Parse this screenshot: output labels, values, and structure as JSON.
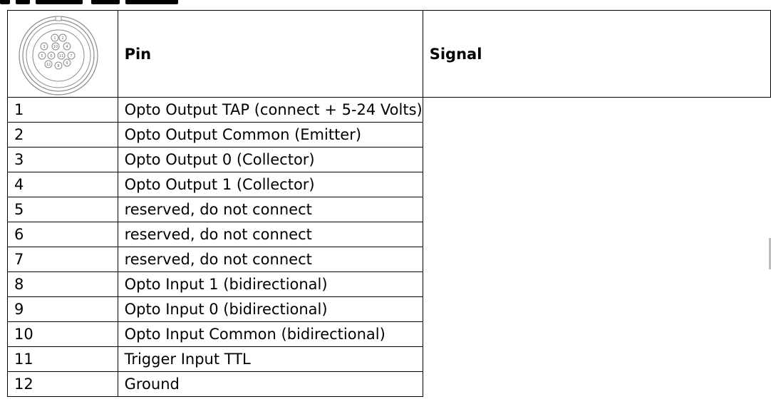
{
  "table": {
    "headers": {
      "pin": "Pin",
      "signal": "Signal"
    },
    "rows": [
      {
        "pin": "1",
        "signal": "Opto Output TAP (connect + 5-24 Volts)"
      },
      {
        "pin": "2",
        "signal": "Opto Output Common (Emitter)"
      },
      {
        "pin": "3",
        "signal": "Opto Output 0 (Collector)"
      },
      {
        "pin": "4",
        "signal": "Opto Output 1 (Collector)"
      },
      {
        "pin": "5",
        "signal": "reserved, do not connect"
      },
      {
        "pin": "6",
        "signal": "reserved, do not connect"
      },
      {
        "pin": "7",
        "signal": "reserved, do not connect"
      },
      {
        "pin": "8",
        "signal": "Opto Input 1 (bidirectional)"
      },
      {
        "pin": "9",
        "signal": "Opto Input 0 (bidirectional)"
      },
      {
        "pin": "10",
        "signal": "Opto Input Common (bidirectional)"
      },
      {
        "pin": "11",
        "signal": "Trigger Input TTL"
      },
      {
        "pin": "12",
        "signal": "Ground"
      }
    ]
  },
  "connector": {
    "icon": "circular-12-pin-connector-icon",
    "pin_labels": [
      "1",
      "2",
      "3",
      "4",
      "5",
      "6",
      "7",
      "8",
      "9",
      "10",
      "11",
      "12"
    ]
  }
}
